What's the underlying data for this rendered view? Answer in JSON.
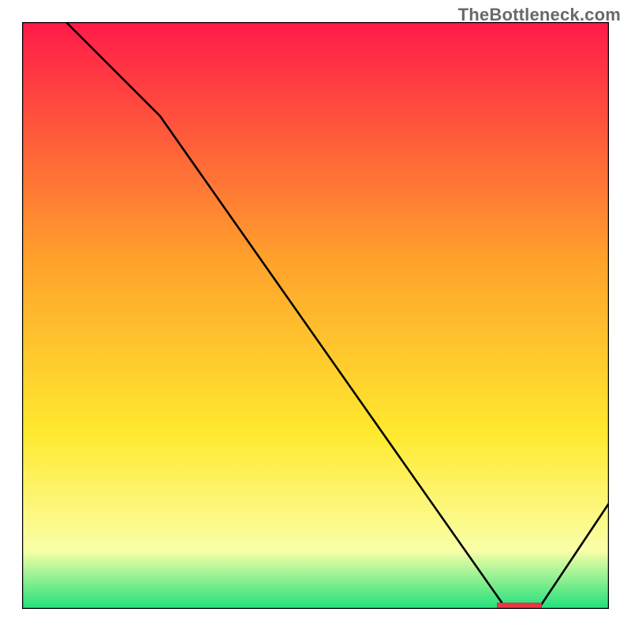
{
  "watermark": "TheBottleneck.com",
  "colors": {
    "gradient_top": "#ff1a49",
    "gradient_mid1": "#ffa02c",
    "gradient_mid2": "#ffe92e",
    "gradient_mid3": "#faffa8",
    "gradient_bottom": "#1fe07b",
    "line": "#000000",
    "frame": "#000000",
    "bar_fill": "#ee3744",
    "bar_stroke": "#cf2c38",
    "watermark": "#696969"
  },
  "chart_data": {
    "type": "line",
    "x": [
      0.0,
      0.075,
      0.235,
      0.825,
      0.88,
      1.0
    ],
    "y": [
      1.06,
      1.0,
      0.84,
      0.0,
      0.0,
      0.18
    ],
    "xlim": [
      0,
      1
    ],
    "ylim": [
      0,
      1
    ],
    "xlabel": "",
    "ylabel": "",
    "title": "",
    "annotations": [
      {
        "kind": "bar",
        "x0": 0.81,
        "x1": 0.885,
        "y": 0.01
      }
    ],
    "background": "vertical-gradient red→orange→yellow→green",
    "notes": "y clipped above 1.0 by plot frame; x,y normalized to axis range"
  }
}
